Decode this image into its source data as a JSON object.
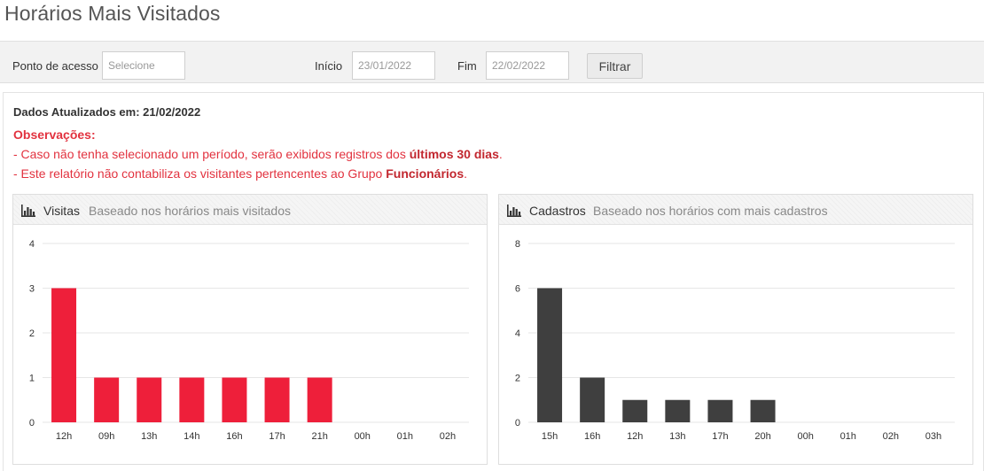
{
  "page": {
    "title": "Horários Mais Visitados"
  },
  "filters": {
    "access_point_label": "Ponto de acesso",
    "access_point_placeholder": "Selecione",
    "start_label": "Início",
    "start_value": "23/01/2022",
    "end_label": "Fim",
    "end_value": "22/02/2022",
    "filter_button": "Filtrar"
  },
  "info": {
    "updated": "Dados Atualizados em: 21/02/2022",
    "obs_title": "Observações:",
    "obs1_prefix": "- Caso não tenha selecionado um período, serão exibidos registros dos ",
    "obs1_bold": "últimos 30 dias",
    "obs1_suffix": ".",
    "obs2_prefix": "- Este relatório não contabiliza os visitantes pertencentes ao Grupo ",
    "obs2_bold": "Funcionários",
    "obs2_suffix": "."
  },
  "panels": {
    "visits": {
      "title": "Visitas",
      "subtitle": "Baseado nos horários mais visitados"
    },
    "registrations": {
      "title": "Cadastros",
      "subtitle": "Baseado nos horários com mais cadastros"
    }
  },
  "colors": {
    "visits_bar": "#ee1f3a",
    "registrations_bar": "#3f3f3f",
    "accent_red": "#e2323f"
  },
  "chart_data": [
    {
      "type": "bar",
      "categories": [
        "12h",
        "09h",
        "13h",
        "14h",
        "16h",
        "17h",
        "21h",
        "00h",
        "01h",
        "02h"
      ],
      "values": [
        3,
        1,
        1,
        1,
        1,
        1,
        1,
        0,
        0,
        0
      ],
      "yticks": [
        0,
        1,
        2,
        3,
        4
      ],
      "ylim": [
        0,
        4
      ],
      "grid": true,
      "color": "#ee1f3a"
    },
    {
      "type": "bar",
      "categories": [
        "15h",
        "16h",
        "12h",
        "13h",
        "17h",
        "20h",
        "00h",
        "01h",
        "02h",
        "03h"
      ],
      "values": [
        6,
        2,
        1,
        1,
        1,
        1,
        0,
        0,
        0,
        0
      ],
      "yticks": [
        0,
        2,
        4,
        6,
        8
      ],
      "ylim": [
        0,
        8
      ],
      "grid": true,
      "color": "#3f3f3f"
    }
  ]
}
